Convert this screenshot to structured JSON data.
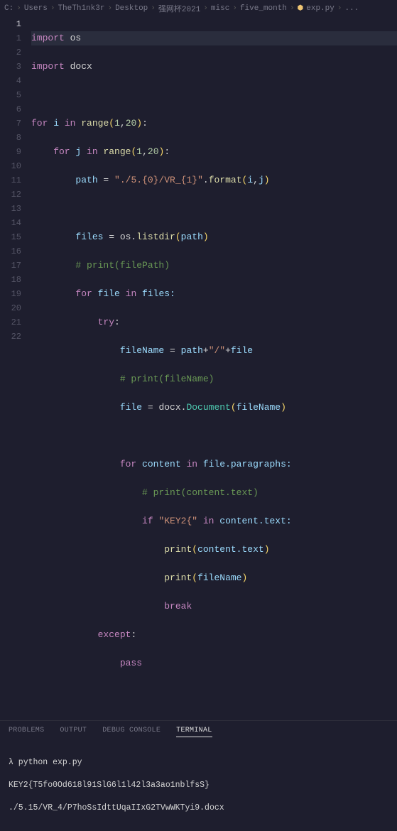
{
  "breadcrumb": {
    "parts": [
      "C:",
      "Users",
      "TheTh1nk3r",
      "Desktop",
      "强网杯2021",
      "misc",
      "five_month"
    ],
    "file": "exp.py",
    "trail": "..."
  },
  "gutter": {
    "current": "1",
    "lines": [
      "1",
      "2",
      "3",
      "4",
      "5",
      "6",
      "7",
      "8",
      "9",
      "10",
      "11",
      "12",
      "13",
      "14",
      "15",
      "16",
      "17",
      "18",
      "19",
      "20",
      "21",
      "22"
    ]
  },
  "code": {
    "l1a": "import",
    "l1b": " os",
    "l2a": "import",
    "l2b": " docx",
    "l3": "",
    "l4a": "for",
    "l4b": " i ",
    "l4c": "in",
    "l4d": " ",
    "l4e": "range",
    "l4f": "(",
    "l4g": "1",
    "l4h": ",",
    "l4i": "20",
    "l4j": ")",
    "l4k": ":",
    "l5a": "    for",
    "l5b": " j ",
    "l5c": "in",
    "l5d": " ",
    "l5e": "range",
    "l5f": "(",
    "l5g": "1",
    "l5h": ",",
    "l5i": "20",
    "l5j": ")",
    "l5k": ":",
    "l6a": "        path ",
    "l6b": "=",
    "l6c": " ",
    "l6d": "\"./5.{0}/VR_{1}\"",
    "l6e": ".",
    "l6f": "format",
    "l6g": "(",
    "l6h": "i",
    "l6i": ",",
    "l6j": "j",
    "l6k": ")",
    "l7": "",
    "l8a": "        files ",
    "l8b": "=",
    "l8c": " os.",
    "l8d": "listdir",
    "l8e": "(",
    "l8f": "path",
    "l8g": ")",
    "l9": "        # print(filePath)",
    "l10a": "        for",
    "l10b": " file ",
    "l10c": "in",
    "l10d": " files:",
    "l11a": "            try",
    "l11b": ":",
    "l12a": "                fileName ",
    "l12b": "=",
    "l12c": " path",
    "l12d": "+",
    "l12e": "\"/\"",
    "l12f": "+",
    "l12g": "file",
    "l13": "                # print(fileName)",
    "l14a": "                file ",
    "l14b": "=",
    "l14c": " docx.",
    "l14d": "Document",
    "l14e": "(",
    "l14f": "fileName",
    "l14g": ")",
    "l15": "",
    "l16a": "                for",
    "l16b": " content ",
    "l16c": "in",
    "l16d": " file.paragraphs:",
    "l17": "                    # print(content.text)",
    "l18a": "                    if",
    "l18b": " ",
    "l18c": "\"KEY2{\"",
    "l18d": " ",
    "l18e": "in",
    "l18f": " content.text:",
    "l19a": "                        ",
    "l19b": "print",
    "l19c": "(",
    "l19d": "content.text",
    "l19e": ")",
    "l20a": "                        ",
    "l20b": "print",
    "l20c": "(",
    "l20d": "fileName",
    "l20e": ")",
    "l21a": "                        ",
    "l21b": "break",
    "l22a": "            except",
    "l22b": ":",
    "l23a": "                pass"
  },
  "panel": {
    "tabs": {
      "problems": "PROBLEMS",
      "output": "OUTPUT",
      "debug": "DEBUG CONSOLE",
      "terminal": "TERMINAL"
    }
  },
  "terminal": {
    "l1": "λ python exp.py",
    "l2": "KEY2{T5fo0Od618l91SlG6l1l42l3a3ao1nblfsS}",
    "l3": "./5.15/VR_4/P7hoSsIdttUqaIIxG2TVwWKTyi9.docx"
  }
}
